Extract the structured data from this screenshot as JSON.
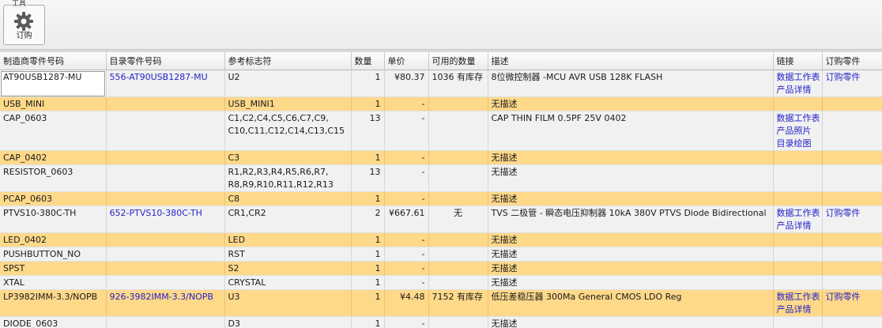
{
  "toolbar": {
    "group_label": "工具",
    "order_button_label": "订购",
    "order_button_icon": "gear-icon"
  },
  "table": {
    "headers": [
      "制造商零件号码",
      "目录零件号码",
      "参考标志符",
      "数量",
      "单价",
      "可用的数量",
      "描述",
      "链接",
      "订购零件"
    ],
    "rows": [
      {
        "mfr": "AT90USB1287-MU",
        "catalog": "556-AT90USB1287-MU",
        "ref": "U2",
        "qty": "1",
        "price": "¥80.37",
        "avail": "1036 有库存",
        "desc": "8位微控制器 -MCU AVR USB 128K FLASH",
        "links": [
          "数据工作表",
          "产品详情"
        ],
        "order": "订购零件"
      },
      {
        "mfr": "USB_MINI",
        "catalog": "",
        "ref": "USB_MINI1",
        "qty": "1",
        "price": "-",
        "avail": "",
        "desc": "无描述",
        "links": [],
        "order": ""
      },
      {
        "mfr": "CAP_0603",
        "catalog": "",
        "ref": "C1,C2,C4,C5,C6,C7,C9,\nC10,C11,C12,C14,C13,C15",
        "qty": "13",
        "price": "-",
        "avail": "",
        "desc": "CAP THIN FILM 0.5PF 25V 0402",
        "links": [
          "数据工作表",
          "产品照片",
          "目录绘图"
        ],
        "order": ""
      },
      {
        "mfr": "CAP_0402",
        "catalog": "",
        "ref": "C3",
        "qty": "1",
        "price": "-",
        "avail": "",
        "desc": "无描述",
        "links": [],
        "order": ""
      },
      {
        "mfr": "RESISTOR_0603",
        "catalog": "",
        "ref": "R1,R2,R3,R4,R5,R6,R7,\nR8,R9,R10,R11,R12,R13",
        "qty": "13",
        "price": "-",
        "avail": "",
        "desc": "无描述",
        "links": [],
        "order": ""
      },
      {
        "mfr": "PCAP_0603",
        "catalog": "",
        "ref": "C8",
        "qty": "1",
        "price": "-",
        "avail": "",
        "desc": "无描述",
        "links": [],
        "order": ""
      },
      {
        "mfr": "PTVS10-380C-TH",
        "catalog": "652-PTVS10-380C-TH",
        "ref": "CR1,CR2",
        "qty": "2",
        "price": "¥667.61",
        "avail": "无",
        "desc": "TVS 二极管 - 瞬态电压抑制器 10kA 380V PTVS Diode Bidirectional",
        "links": [
          "数据工作表",
          "产品详情"
        ],
        "order": "订购零件"
      },
      {
        "mfr": "LED_0402",
        "catalog": "",
        "ref": "LED",
        "qty": "1",
        "price": "-",
        "avail": "",
        "desc": "无描述",
        "links": [],
        "order": ""
      },
      {
        "mfr": "PUSHBUTTON_NO",
        "catalog": "",
        "ref": "RST",
        "qty": "1",
        "price": "-",
        "avail": "",
        "desc": "无描述",
        "links": [],
        "order": ""
      },
      {
        "mfr": "SPST",
        "catalog": "",
        "ref": "S2",
        "qty": "1",
        "price": "-",
        "avail": "",
        "desc": "无描述",
        "links": [],
        "order": ""
      },
      {
        "mfr": "XTAL",
        "catalog": "",
        "ref": "CRYSTAL",
        "qty": "1",
        "price": "-",
        "avail": "",
        "desc": "无描述",
        "links": [],
        "order": ""
      },
      {
        "mfr": "LP3982IMM-3.3/NOPB",
        "catalog": "926-3982IMM-3.3/NOPB",
        "ref": "U3",
        "qty": "1",
        "price": "¥4.48",
        "avail": "7152 有库存",
        "desc": "低压差稳压器 300Ma General CMOS LDO Reg",
        "links": [
          "数据工作表",
          "产品详情"
        ],
        "order": "订购零件"
      },
      {
        "mfr": "DIODE_0603",
        "catalog": "",
        "ref": "D3",
        "qty": "1",
        "price": "-",
        "avail": "",
        "desc": "无描述",
        "links": [],
        "order": ""
      }
    ]
  },
  "colors": {
    "row_highlight": "#ffd98a",
    "row_normal": "#f1f1f1",
    "link": "#2323c8"
  }
}
